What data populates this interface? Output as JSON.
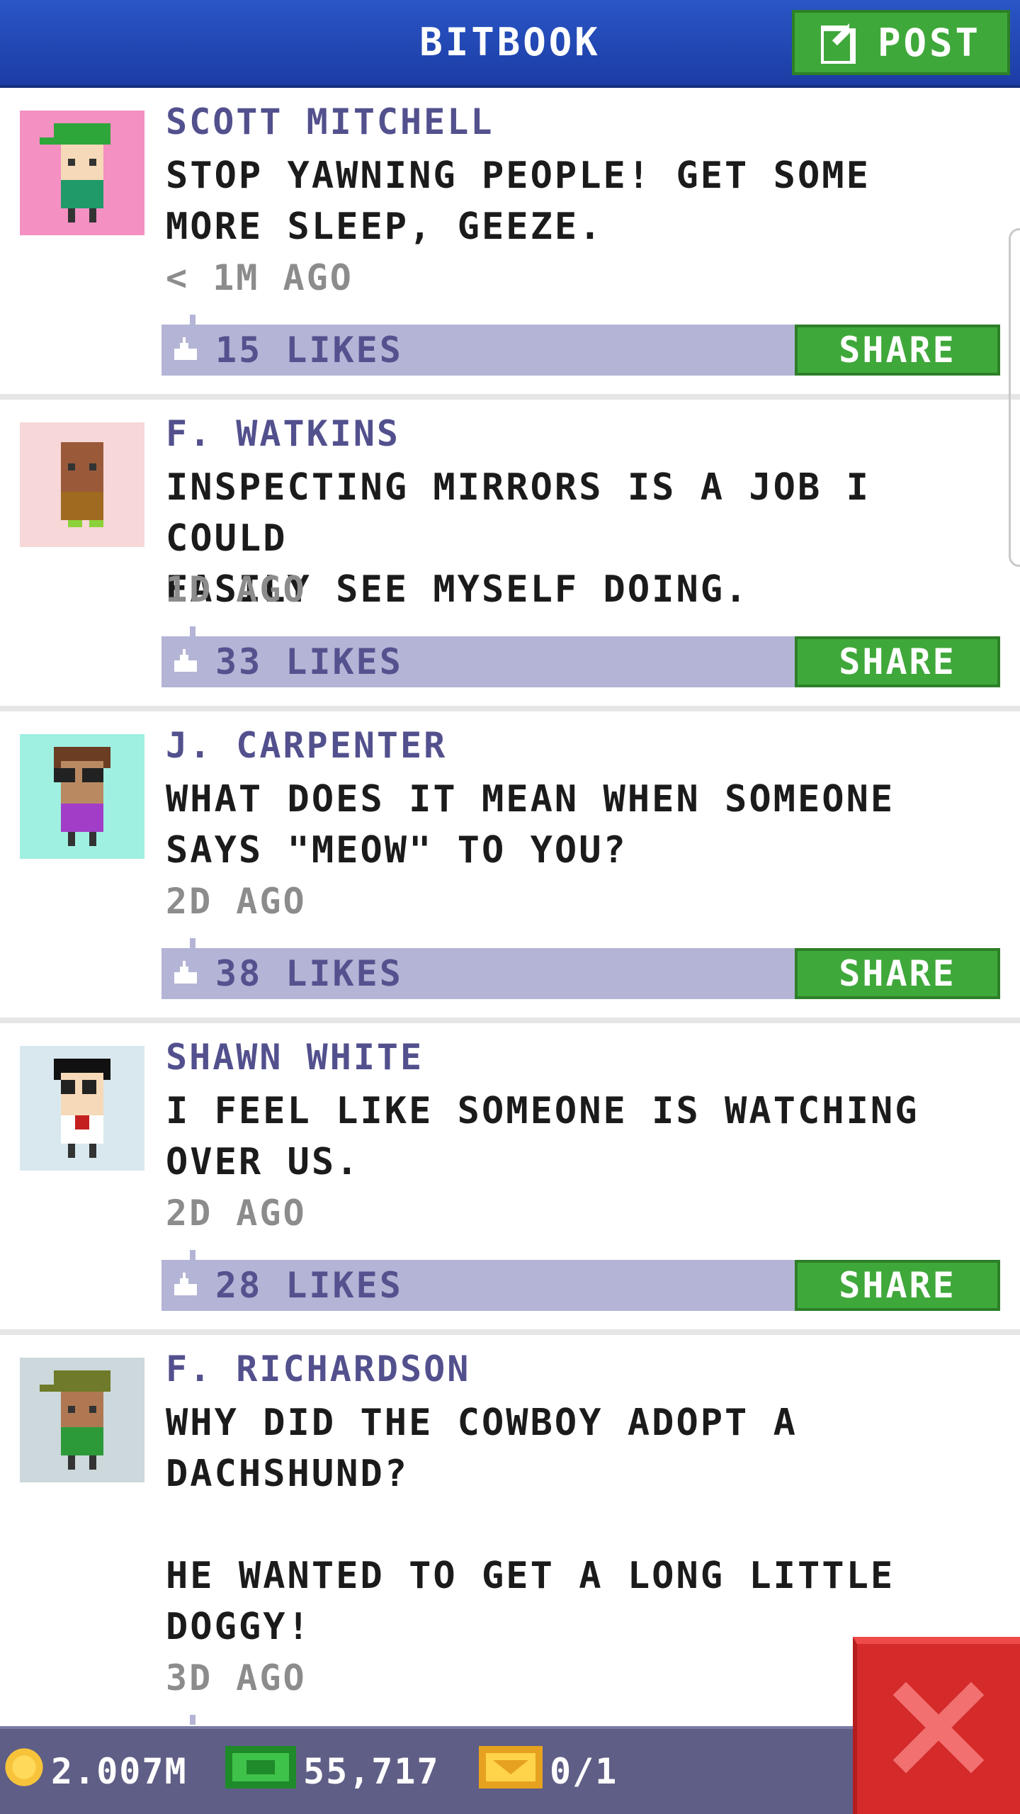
{
  "header": {
    "title": "BITBOOK",
    "post_label": "POST"
  },
  "posts": [
    {
      "author": "SCOTT MITCHELL",
      "text": "STOP YAWNING PEOPLE! GET SOME\nMORE SLEEP, GEEZE.",
      "time": "< 1M AGO",
      "likes": "15 LIKES",
      "share": "SHARE",
      "avatar_bg": "#f490c2"
    },
    {
      "author": "F. WATKINS",
      "text": "INSPECTING MIRRORS IS A JOB I COULD\nEASILY SEE MYSELF DOING.",
      "time": "1D AGO",
      "likes": "33 LIKES",
      "share": "SHARE",
      "avatar_bg": "#f7d7d8"
    },
    {
      "author": "J. CARPENTER",
      "text": "WHAT DOES IT MEAN WHEN SOMEONE\nSAYS \"MEOW\" TO YOU?",
      "time": "2D AGO",
      "likes": "38 LIKES",
      "share": "SHARE",
      "avatar_bg": "#9ff0e1"
    },
    {
      "author": "SHAWN WHITE",
      "text": "I FEEL LIKE SOMEONE IS WATCHING\nOVER US.",
      "time": "2D AGO",
      "likes": "28 LIKES",
      "share": "SHARE",
      "avatar_bg": "#d8e8ee"
    },
    {
      "author": "F. RICHARDSON",
      "text": "WHY DID THE COWBOY ADOPT A\nDACHSHUND?\n\nHE WANTED TO GET A LONG LITTLE\nDOGGY!",
      "time": "3D AGO",
      "avatar_bg": "#ccd8db"
    }
  ],
  "footer": {
    "coins": "2.007M",
    "bux": "55,717",
    "tickets": "0/1"
  },
  "colors": {
    "header": "#2a56c6",
    "accent_green": "#3fa83a",
    "likes_bar": "#b4b4d6",
    "close_red": "#d42a2a"
  }
}
